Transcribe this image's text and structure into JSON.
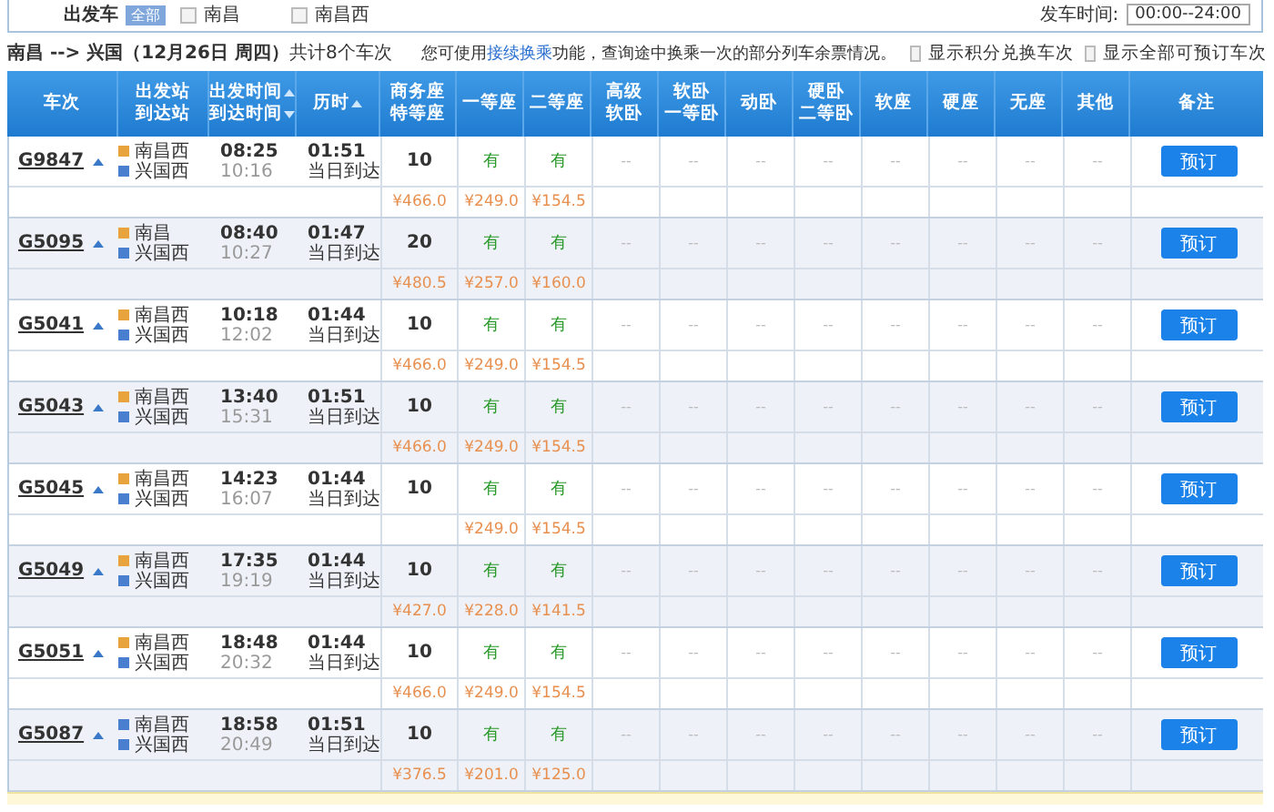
{
  "filter": {
    "label": "出发车",
    "badge": "全部",
    "stations": [
      {
        "label": "南昌",
        "checked": false
      },
      {
        "label": "南昌西",
        "checked": false
      }
    ],
    "time_label": "发车时间:",
    "time_value": "00:00--24:00"
  },
  "summary": {
    "route": "**南昌 --> 兴国（12月26日 周四）**共计8个车次",
    "hint_before": "您可使用",
    "hint_link": "接续换乘",
    "hint_after": "功能，查询途中换乘一次的部分列车余票情况。",
    "options": [
      {
        "label": "显示积分兑换车次",
        "checked": false
      },
      {
        "label": "显示全部可预订车次",
        "checked": false
      }
    ]
  },
  "table": {
    "columns": [
      {
        "lines": [
          "车次"
        ],
        "kind": "plain"
      },
      {
        "lines": [
          "出发站",
          "到达站"
        ],
        "kind": "plain"
      },
      {
        "lines": [
          "出发时间",
          "到达时间"
        ],
        "kind": "sort_both"
      },
      {
        "lines": [
          "历时"
        ],
        "kind": "sort_up"
      },
      {
        "lines": [
          "商务座",
          "特等座"
        ],
        "kind": "plain"
      },
      {
        "lines": [
          "一等座"
        ],
        "kind": "plain"
      },
      {
        "lines": [
          "二等座"
        ],
        "kind": "plain"
      },
      {
        "lines": [
          "高级",
          "软卧"
        ],
        "kind": "plain"
      },
      {
        "lines": [
          "软卧",
          "一等卧"
        ],
        "kind": "plain"
      },
      {
        "lines": [
          "动卧"
        ],
        "kind": "plain"
      },
      {
        "lines": [
          "硬卧",
          "二等卧"
        ],
        "kind": "plain"
      },
      {
        "lines": [
          "软座"
        ],
        "kind": "plain"
      },
      {
        "lines": [
          "硬座"
        ],
        "kind": "plain"
      },
      {
        "lines": [
          "无座"
        ],
        "kind": "plain"
      },
      {
        "lines": [
          "其他"
        ],
        "kind": "plain"
      },
      {
        "lines": [
          "备注"
        ],
        "kind": "plain"
      }
    ],
    "rows": [
      {
        "train": "G9847",
        "from": {
          "name": "南昌西",
          "kind": "start"
        },
        "to": {
          "name": "兴国西",
          "kind": "pass"
        },
        "depart": "08:25",
        "arrive": "10:16",
        "duration": "01:51",
        "arrival_day": "当日到达",
        "seats": [
          "10",
          "有",
          "有",
          "--",
          "--",
          "--",
          "--",
          "--",
          "--",
          "--",
          "--"
        ],
        "prices": [
          "¥466.0",
          "¥249.0",
          "¥154.5"
        ],
        "button": "预订"
      },
      {
        "train": "G5095",
        "from": {
          "name": "南昌",
          "kind": "start"
        },
        "to": {
          "name": "兴国西",
          "kind": "pass"
        },
        "depart": "08:40",
        "arrive": "10:27",
        "duration": "01:47",
        "arrival_day": "当日到达",
        "seats": [
          "20",
          "有",
          "有",
          "--",
          "--",
          "--",
          "--",
          "--",
          "--",
          "--",
          "--"
        ],
        "prices": [
          "¥480.5",
          "¥257.0",
          "¥160.0"
        ],
        "button": "预订"
      },
      {
        "train": "G5041",
        "from": {
          "name": "南昌西",
          "kind": "start"
        },
        "to": {
          "name": "兴国西",
          "kind": "pass"
        },
        "depart": "10:18",
        "arrive": "12:02",
        "duration": "01:44",
        "arrival_day": "当日到达",
        "seats": [
          "10",
          "有",
          "有",
          "--",
          "--",
          "--",
          "--",
          "--",
          "--",
          "--",
          "--"
        ],
        "prices": [
          "¥466.0",
          "¥249.0",
          "¥154.5"
        ],
        "button": "预订"
      },
      {
        "train": "G5043",
        "from": {
          "name": "南昌西",
          "kind": "start"
        },
        "to": {
          "name": "兴国西",
          "kind": "pass"
        },
        "depart": "13:40",
        "arrive": "15:31",
        "duration": "01:51",
        "arrival_day": "当日到达",
        "seats": [
          "10",
          "有",
          "有",
          "--",
          "--",
          "--",
          "--",
          "--",
          "--",
          "--",
          "--"
        ],
        "prices": [
          "¥466.0",
          "¥249.0",
          "¥154.5"
        ],
        "button": "预订"
      },
      {
        "train": "G5045",
        "from": {
          "name": "南昌西",
          "kind": "start"
        },
        "to": {
          "name": "兴国西",
          "kind": "pass"
        },
        "depart": "14:23",
        "arrive": "16:07",
        "duration": "01:44",
        "arrival_day": "当日到达",
        "seats": [
          "10",
          "有",
          "有",
          "--",
          "--",
          "--",
          "--",
          "--",
          "--",
          "--",
          "--"
        ],
        "prices": [
          {
            "kind": "empty"
          },
          {
            "kind": "fare",
            "text": "¥249.0"
          },
          {
            "kind": "fare",
            "text": "¥154.5"
          }
        ],
        "button": "预订"
      },
      {
        "train": "G5049",
        "from": {
          "name": "南昌西",
          "kind": "start"
        },
        "to": {
          "name": "兴国西",
          "kind": "pass"
        },
        "depart": "17:35",
        "arrive": "19:19",
        "duration": "01:44",
        "arrival_day": "当日到达",
        "seats": [
          "10",
          "有",
          "有",
          "--",
          "--",
          "--",
          "--",
          "--",
          "--",
          "--",
          "--"
        ],
        "prices": [
          "¥427.0",
          "¥228.0",
          "¥141.5"
        ],
        "button": "预订"
      },
      {
        "train": "G5051",
        "from": {
          "name": "南昌西",
          "kind": "start"
        },
        "to": {
          "name": "兴国西",
          "kind": "pass"
        },
        "depart": "18:48",
        "arrive": "20:32",
        "duration": "01:44",
        "arrival_day": "当日到达",
        "seats": [
          "10",
          "有",
          "有",
          "--",
          "--",
          "--",
          "--",
          "--",
          "--",
          "--",
          "--"
        ],
        "prices": [
          "¥466.0",
          "¥249.0",
          "¥154.5"
        ],
        "button": "预订"
      },
      {
        "train": "G5087",
        "from": {
          "name": "南昌西",
          "kind": "pass"
        },
        "to": {
          "name": "兴国西",
          "kind": "pass"
        },
        "depart": "18:58",
        "arrive": "20:49",
        "duration": "01:51",
        "arrival_day": "当日到达",
        "seats": [
          "10",
          "有",
          "有",
          "--",
          "--",
          "--",
          "--",
          "--",
          "--",
          "--",
          "--"
        ],
        "prices": [
          "¥376.5",
          "¥201.0",
          "¥125.0"
        ],
        "button": "预订"
      }
    ]
  }
}
